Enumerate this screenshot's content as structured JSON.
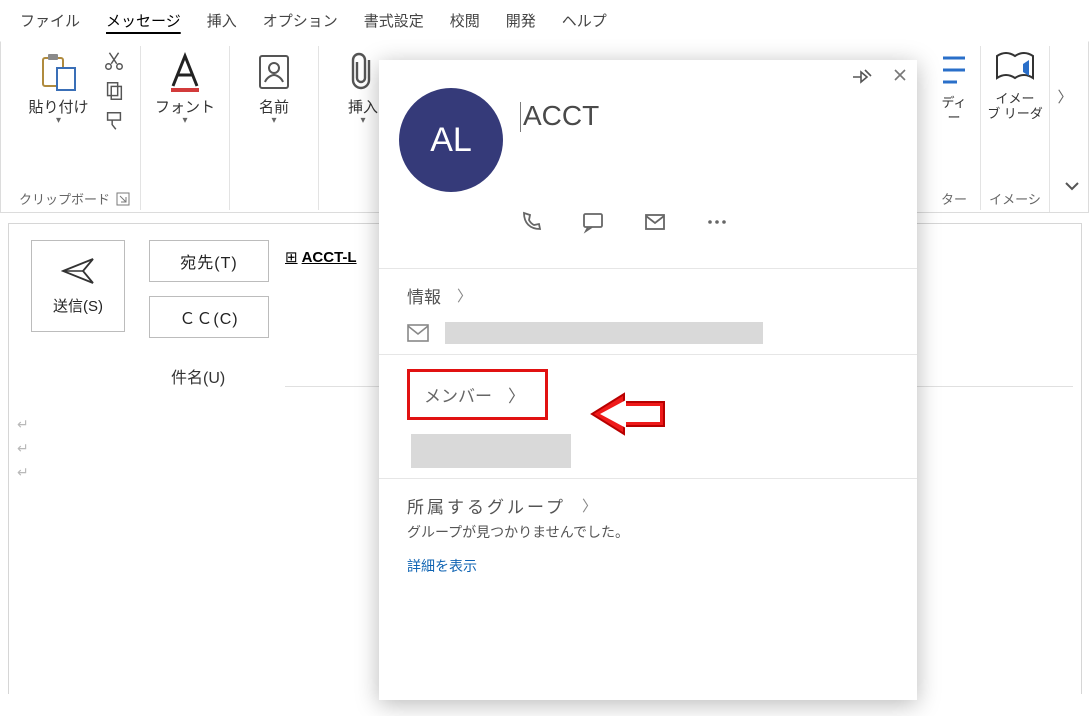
{
  "tabs": {
    "file": "ファイル",
    "message": "メッセージ",
    "insert": "挿入",
    "options": "オプション",
    "format": "書式設定",
    "review": "校閲",
    "developer": "開発",
    "help": "ヘルプ"
  },
  "ribbon": {
    "paste": "貼り付け",
    "clipboard_caption": "クリップボード",
    "font": "フォント",
    "names": "名前",
    "insert": "挿入",
    "right_a_line1": "ディ",
    "right_a_line2": "ー",
    "right_a_caption": "ター",
    "right_b_line1": "イメー",
    "right_b_line2": "ブ リーダ",
    "right_b_caption": "イメーシ"
  },
  "compose": {
    "send": "送信(S)",
    "to": "宛先(T)",
    "cc": "ＣＣ(C)",
    "subject_label": "件名(U)",
    "to_value": "ACCT-L"
  },
  "card": {
    "avatar_initials": "AL",
    "name": "ACCT",
    "info": "情報",
    "members": "メンバー",
    "groups": "所属するグループ",
    "groups_msg": "グループが見つかりませんでした。",
    "details_link": "詳細を表示"
  }
}
